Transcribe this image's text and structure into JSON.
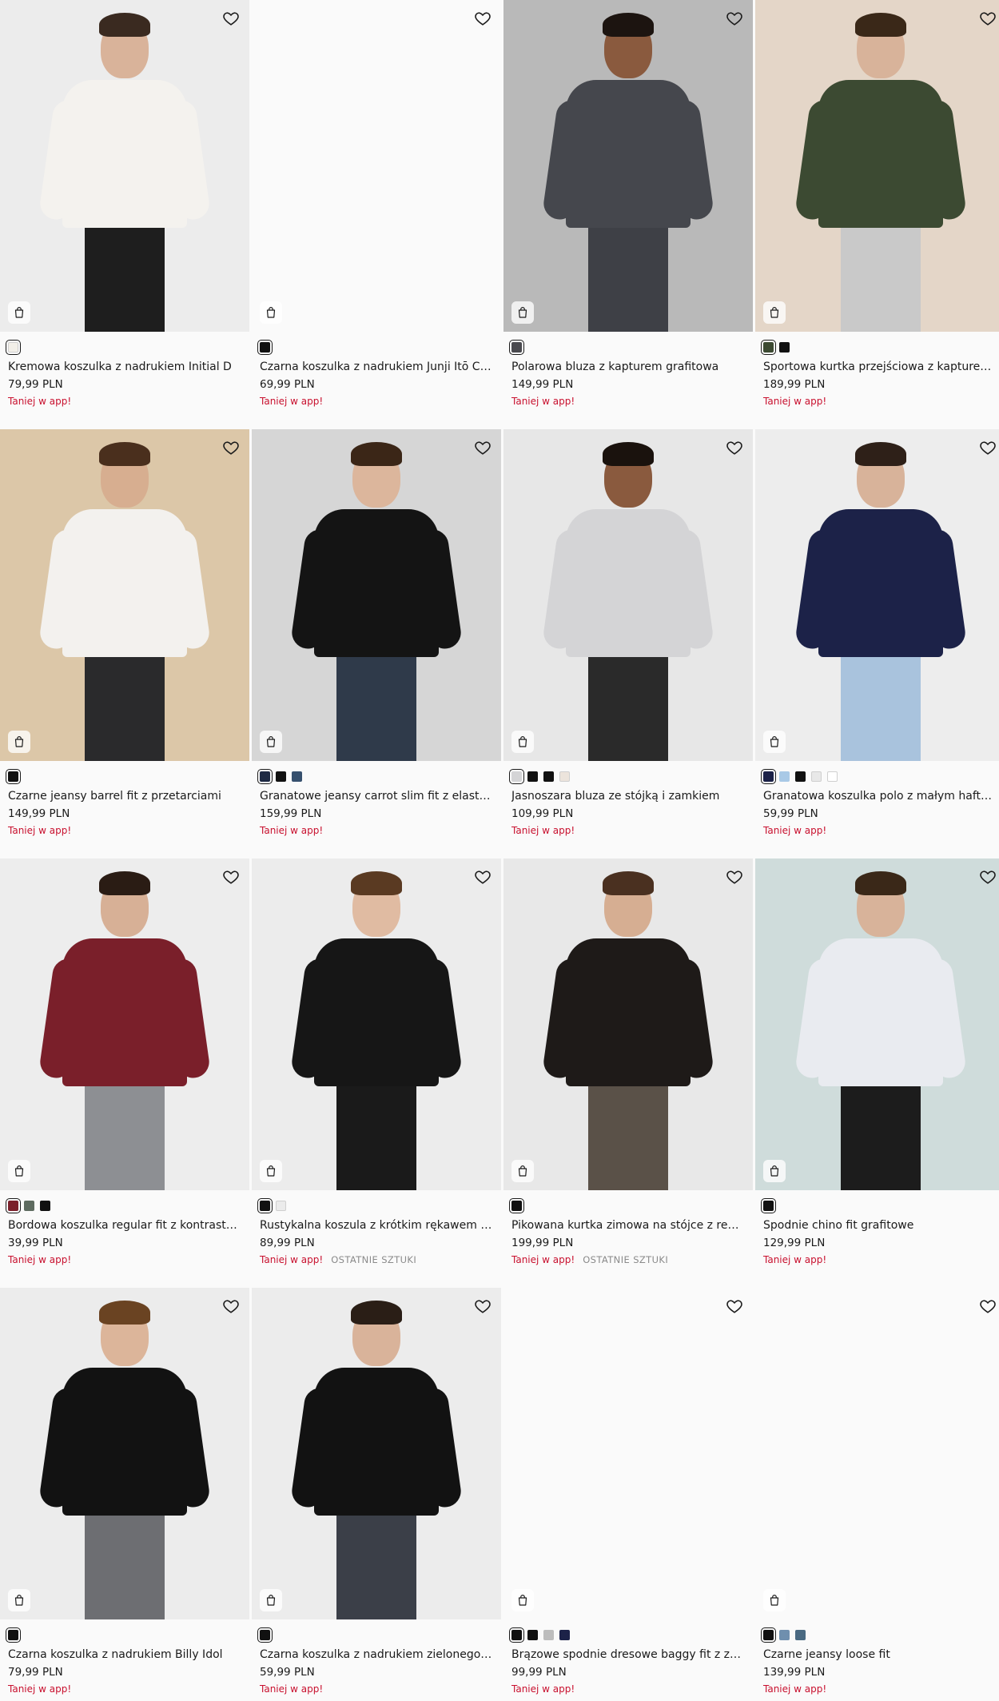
{
  "products": [
    {
      "name": "Kremowa koszulka z nadrukiem Initial D",
      "price": "79,99 PLN",
      "promo": "Taniej w app!",
      "badge": "",
      "bg": "#ececec",
      "top": "#f4f2ee",
      "bottom": "#1e1e1e",
      "skin": "#d9b39a",
      "hair": "#3a2a20",
      "swatches": [
        "#f2efe8"
      ]
    },
    {
      "name": "Czarna koszulka z nadrukiem Junji Itō Cat Diary",
      "price": "69,99 PLN",
      "promo": "Taniej w app!",
      "badge": "",
      "bg": "#fafafa",
      "top": "",
      "bottom": "",
      "skin": "",
      "hair": "",
      "swatches": [
        "#111111"
      ]
    },
    {
      "name": "Polarowa bluza z kapturem grafitowa",
      "price": "149,99 PLN",
      "promo": "Taniej w app!",
      "badge": "",
      "bg": "#b9b9b9",
      "top": "#45474d",
      "bottom": "#3e4046",
      "skin": "#8a5a3e",
      "hair": "#1c1410",
      "swatches": [
        "#4a4a4f"
      ]
    },
    {
      "name": "Sportowa kurtka przejściowa z kapturem oliwkowa",
      "price": "189,99 PLN",
      "promo": "Taniej w app!",
      "badge": "",
      "bg": "#e4d6c8",
      "top": "#3c4a32",
      "bottom": "#c9c9c9",
      "skin": "#d8b39a",
      "hair": "#3a2818",
      "swatches": [
        "#3c4a32",
        "#111111"
      ]
    },
    {
      "name": "Czarne jeansy barrel fit z przetarciami",
      "price": "149,99 PLN",
      "promo": "Taniej w app!",
      "badge": "",
      "bg": "#dcc7a8",
      "top": "#f3f1ee",
      "bottom": "#2a2a2c",
      "skin": "#d7ae90",
      "hair": "#4a2f1d",
      "swatches": [
        "#111111"
      ]
    },
    {
      "name": "Granatowe jeansy carrot slim fit z elastycznej tkaniny",
      "price": "159,99 PLN",
      "promo": "Taniej w app!",
      "badge": "",
      "bg": "#d6d6d6",
      "top": "#141414",
      "bottom": "#2f3a4a",
      "skin": "#dcb69c",
      "hair": "#3b2617",
      "swatches": [
        "#1e2a44",
        "#111111",
        "#36506e"
      ]
    },
    {
      "name": "Jasnoszara bluza ze stójką i zamkiem",
      "price": "109,99 PLN",
      "promo": "Taniej w app!",
      "badge": "",
      "bg": "#e7e7e7",
      "top": "#d4d4d6",
      "bottom": "#2a2a2a",
      "skin": "#8a5a3e",
      "hair": "#1a120d",
      "swatches": [
        "#d4d4d6",
        "#111111",
        "#111111",
        "#ece4dc"
      ]
    },
    {
      "name": "Granatowa koszulka polo z małym haftem",
      "price": "59,99 PLN",
      "promo": "Taniej w app!",
      "badge": "",
      "bg": "#ededed",
      "top": "#1c2248",
      "bottom": "#a9c3dd",
      "skin": "#d8b39a",
      "hair": "#2e2018",
      "swatches": [
        "#1c2248",
        "#a9c9e6",
        "#111111",
        "#e8e8e8",
        "#ffffff"
      ]
    },
    {
      "name": "Bordowa koszulka regular fit z kontrastową lamówką",
      "price": "39,99 PLN",
      "promo": "Taniej w app!",
      "badge": "",
      "bg": "#ededed",
      "top": "#7a1f2a",
      "bottom": "#8d8f93",
      "skin": "#d7b096",
      "hair": "#2a1c14",
      "swatches": [
        "#7a1f2a",
        "#5e6b60",
        "#111111"
      ]
    },
    {
      "name": "Rustykalna koszula z krótkim rękawem czarna",
      "price": "89,99 PLN",
      "promo": "Taniej w app!",
      "badge": "OSTATNIE SZTUKI",
      "bg": "#ececec",
      "top": "#161616",
      "bottom": "#1a1a1a",
      "skin": "#e0bba2",
      "hair": "#5a3a22",
      "swatches": [
        "#111111",
        "#ebebeb"
      ]
    },
    {
      "name": "Pikowana kurtka zimowa na stójce z regulacją",
      "price": "199,99 PLN",
      "promo": "Taniej w app!",
      "badge": "OSTATNIE SZTUKI",
      "bg": "#e8e8e8",
      "top": "#1e1a18",
      "bottom": "#5a5148",
      "skin": "#d6ae92",
      "hair": "#4a3020",
      "swatches": [
        "#111111"
      ]
    },
    {
      "name": "Spodnie chino fit grafitowe",
      "price": "129,99 PLN",
      "promo": "Taniej w app!",
      "badge": "",
      "bg": "#cfdcdb",
      "top": "#e9ebf0",
      "bottom": "#1c1c1c",
      "skin": "#d8b39a",
      "hair": "#3a2818",
      "swatches": [
        "#111111"
      ]
    },
    {
      "name": "Czarna koszulka z nadrukiem Billy Idol",
      "price": "79,99 PLN",
      "promo": "Taniej w app!",
      "badge": "",
      "bg": "#ececec",
      "top": "#121212",
      "bottom": "#6d6e72",
      "skin": "#dcb59a",
      "hair": "#6a4322",
      "swatches": [
        "#111111"
      ]
    },
    {
      "name": "Czarna koszulka z nadrukiem zielonego kota",
      "price": "59,99 PLN",
      "promo": "Taniej w app!",
      "badge": "",
      "bg": "#ececec",
      "top": "#121212",
      "bottom": "#3b3f48",
      "skin": "#d9b39a",
      "hair": "#2a1e16",
      "swatches": [
        "#111111"
      ]
    },
    {
      "name": "Brązowe spodnie dresowe baggy fit z zaszewkami",
      "price": "99,99 PLN",
      "promo": "Taniej w app!",
      "badge": "",
      "bg": "#fafafa",
      "top": "",
      "bottom": "",
      "skin": "",
      "hair": "",
      "swatches": [
        "#111111",
        "#111111",
        "#bdbdbd",
        "#1c2248"
      ]
    },
    {
      "name": "Czarne jeansy loose fit",
      "price": "139,99 PLN",
      "promo": "Taniej w app!",
      "badge": "",
      "bg": "#fafafa",
      "top": "",
      "bottom": "",
      "skin": "",
      "hair": "",
      "swatches": [
        "#111111",
        "#6f8fae",
        "#4a6a82"
      ]
    }
  ]
}
